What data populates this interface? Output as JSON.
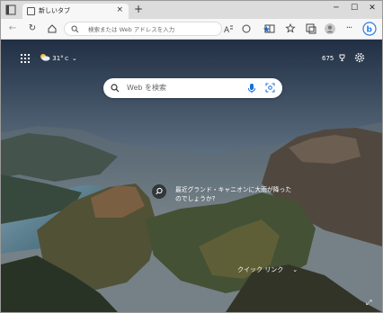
{
  "tab": {
    "title": "新しいタブ",
    "close_glyph": "×"
  },
  "newtab_glyph": "+",
  "window_controls": {
    "minimize": "─",
    "maximize": "☐",
    "close": "✕"
  },
  "omnibox": {
    "placeholder": "検索または Web アドレスを入力"
  },
  "header": {
    "weather": "31°ｃ",
    "points": "675"
  },
  "search": {
    "placeholder": "Web を検索"
  },
  "image_info": {
    "text": "最近グランド・キャニオンに大雨が降ったのでしょうか?"
  },
  "quick_links": {
    "label": "クイック リンク"
  },
  "colors": {
    "accent": "#1a6fd8",
    "tab_strip": "#dcdcdc",
    "toolbar": "#f7f7f7"
  }
}
